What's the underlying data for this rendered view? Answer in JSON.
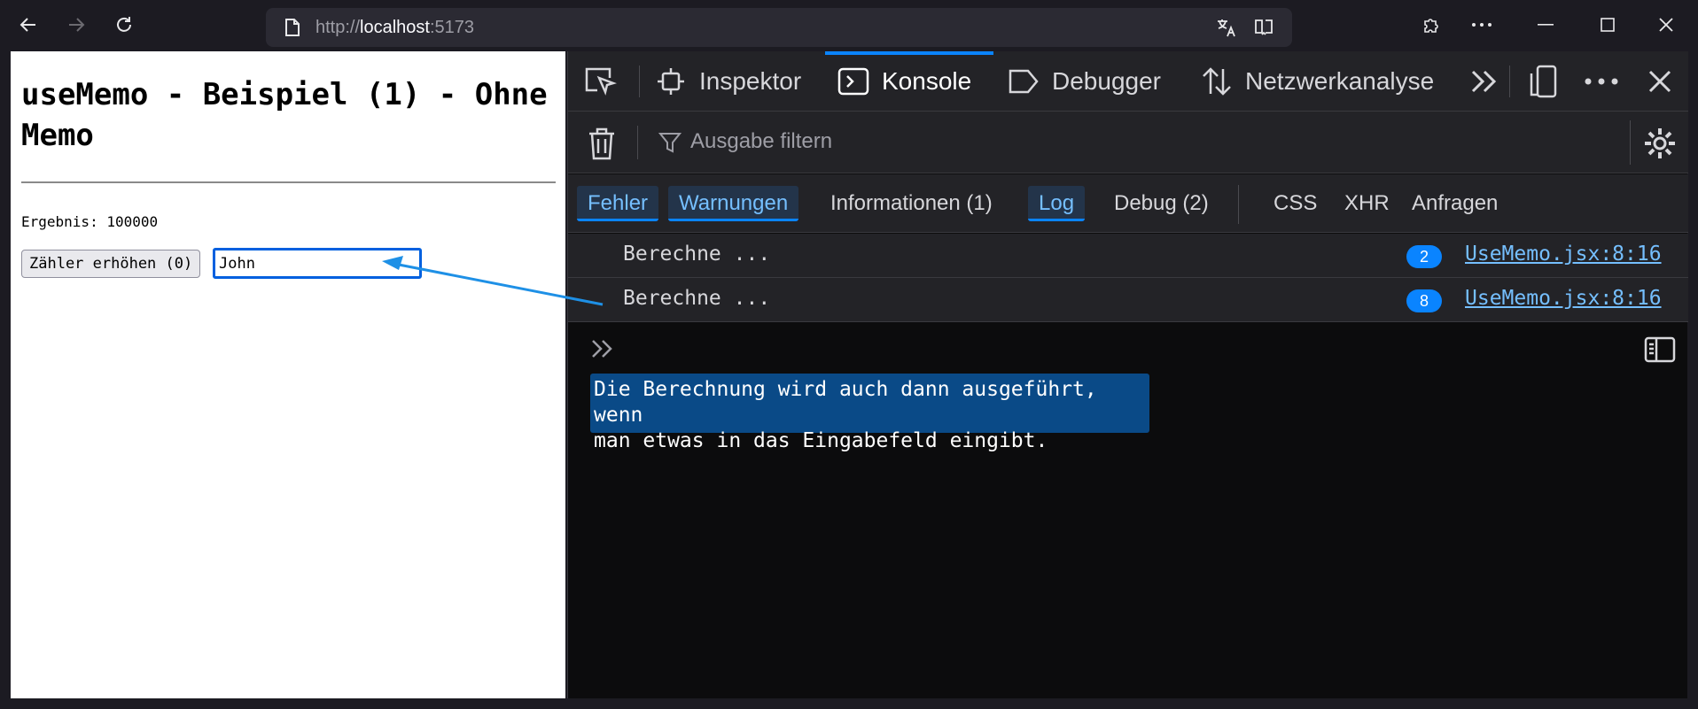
{
  "browser": {
    "url_prefix": "http://",
    "url_host": "localhost",
    "url_port": ":5173"
  },
  "page": {
    "title": "useMemo - Beispiel (1) - Ohne Memo",
    "result": "Ergebnis: 100000",
    "counter_button": "Zähler erhöhen (0)",
    "name_input_value": "John"
  },
  "devtools": {
    "tools": [
      "Inspektor",
      "Konsole",
      "Debugger",
      "Netzwerkanalyse"
    ],
    "active_tool": "Konsole",
    "filter_placeholder": "Ausgabe filtern",
    "levels": {
      "errors": "Fehler",
      "warnings": "Warnungen",
      "info": "Informationen (1)",
      "log": "Log",
      "debug": "Debug (2)",
      "css": "CSS",
      "xhr": "XHR",
      "requests": "Anfragen"
    },
    "messages": [
      {
        "text": "Berechne ...",
        "count": "2",
        "location": "UseMemo.jsx:8:16"
      },
      {
        "text": "Berechne ...",
        "count": "8",
        "location": "UseMemo.jsx:8:16"
      }
    ],
    "annotation_line1": "Die Berechnung wird auch dann ausgeführt, wenn",
    "annotation_line2": "man etwas in das Eingabefeld eingibt."
  },
  "colors": {
    "accent": "#0a84ff",
    "annotation_bg": "#0a4a87",
    "arrow": "#1e90e6"
  }
}
